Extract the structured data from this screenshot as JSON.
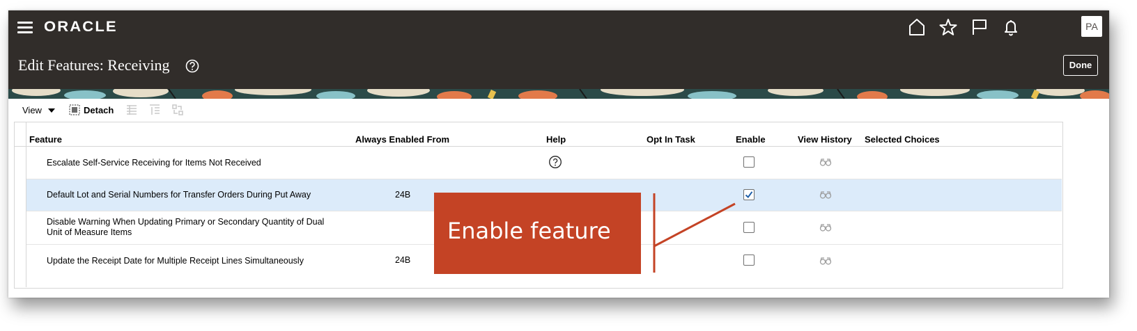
{
  "header": {
    "logo_text": "ORACLE",
    "avatar_initials": "PA",
    "icons": [
      "menu-icon",
      "home-icon",
      "favorites-star-icon",
      "flag-icon",
      "bell-icon"
    ],
    "page_title": "Edit Features: Receiving",
    "done_label": "Done",
    "colors": {
      "bar": "#312d2a",
      "text": "#ffffff"
    }
  },
  "toolbar": {
    "view_label": "View",
    "detach_label": "Detach",
    "disabled_icons": [
      "freeze-icon",
      "wrap-icon",
      "reorder-columns-icon"
    ]
  },
  "table": {
    "columns": [
      "Feature",
      "Always Enabled From",
      "Help",
      "Opt In Task",
      "Enable",
      "View History",
      "Selected Choices"
    ],
    "rows": [
      {
        "feature": "Escalate Self-Service Receiving for Items Not Received",
        "always_enabled_from": "",
        "help": true,
        "enabled": false,
        "selected": false
      },
      {
        "feature": "Default Lot and Serial Numbers for Transfer Orders During Put Away",
        "always_enabled_from": "24B",
        "help": false,
        "enabled": true,
        "selected": true
      },
      {
        "feature_line1": "Disable Warning When Updating Primary or Secondary Quantity of Dual",
        "feature_line2": "Unit of Measure Items",
        "always_enabled_from": "",
        "help": false,
        "enabled": false,
        "selected": false
      },
      {
        "feature": "Update the Receipt Date for Multiple Receipt Lines Simultaneously",
        "always_enabled_from": "24B",
        "help": false,
        "enabled": false,
        "selected": false
      }
    ],
    "selected_row_color": "#dcebfa"
  },
  "annotation": {
    "text": "Enable feature",
    "color": "#c44325"
  }
}
